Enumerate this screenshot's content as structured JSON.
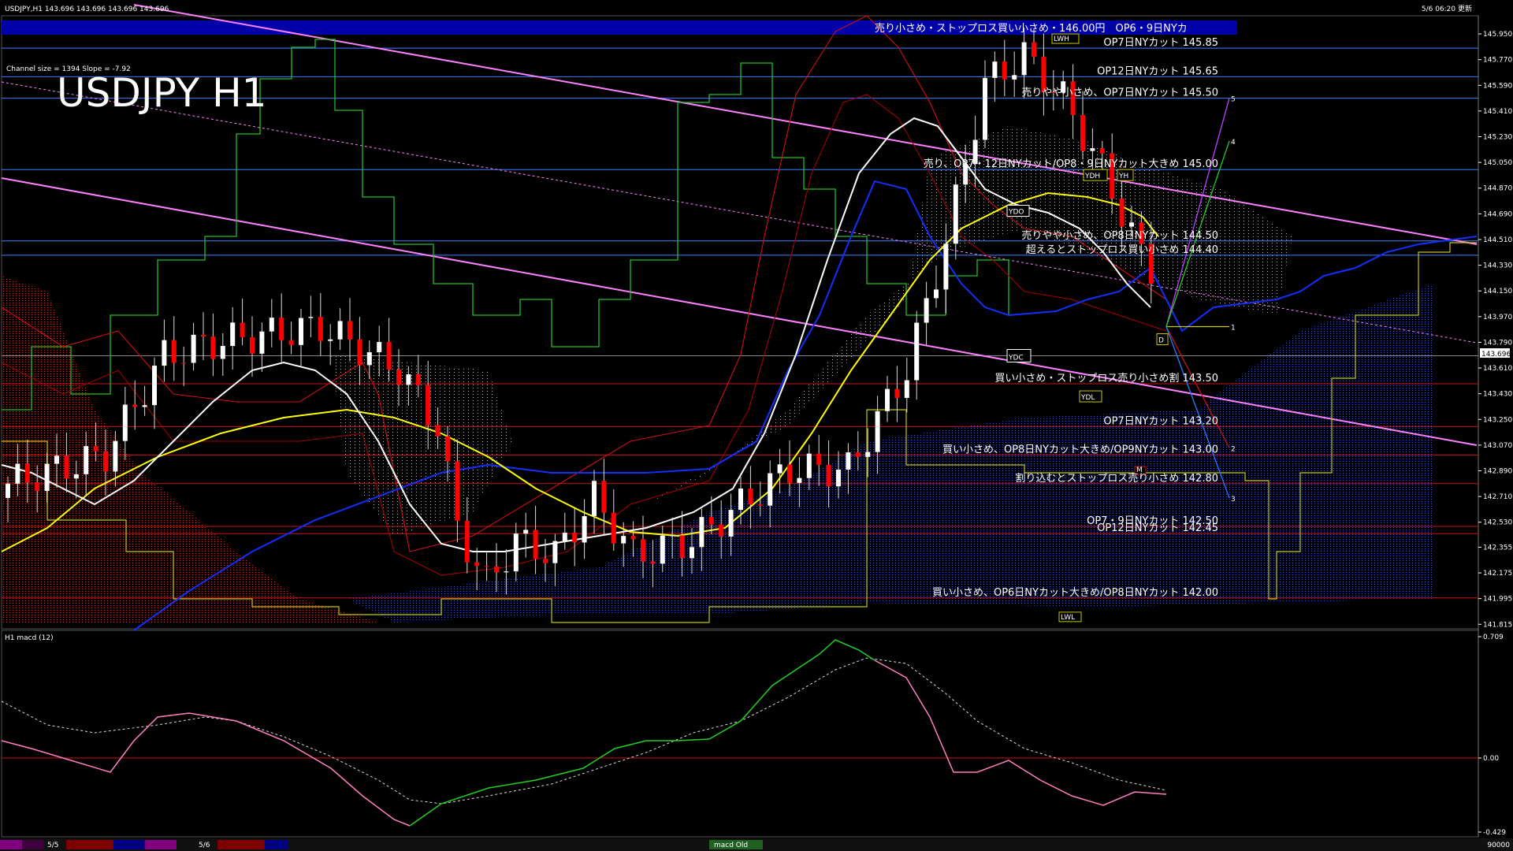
{
  "header": {
    "symbol_info": "USDJPY,H1  143.696 143.696 143.696 143.696",
    "updated": "5/6 06:20 更新",
    "channel_info": "Channel size = 1394 Slope = -7.92"
  },
  "chart_data": {
    "type": "line",
    "title": "USDJPY H1",
    "y_ticks": [
      "145.950",
      "145.770",
      "145.590",
      "145.410",
      "145.230",
      "145.050",
      "144.870",
      "144.690",
      "144.510",
      "144.330",
      "144.150",
      "143.970",
      "143.790",
      "143.610",
      "143.430",
      "143.250",
      "143.070",
      "142.890",
      "142.710",
      "142.530",
      "142.355",
      "142.175",
      "141.995",
      "141.815"
    ],
    "current_price": "143.696",
    "ylim": [
      141.8,
      146.0
    ],
    "levels": [
      {
        "price": 146.0,
        "label": "売り小さめ・ストップロス買い小さめ・146.00円　OP6・9日NYカ"
      },
      {
        "price": 145.85,
        "label": "OP7日NYカット 145.85"
      },
      {
        "price": 145.65,
        "label": "OP12日NYカット 145.65"
      },
      {
        "price": 145.5,
        "label": "売りやや小さめ、OP7日NYカット 145.50"
      },
      {
        "price": 145.0,
        "label": "売り、OP7・12日NYカット/OP8・9日NYカット大きめ 145.00"
      },
      {
        "price": 144.5,
        "label": "売りやや小さめ、OP8日NYカット 144.50"
      },
      {
        "price": 144.4,
        "label": "超えるとストップロス買い小さめ 144.40"
      },
      {
        "price": 143.5,
        "label": "買い小さめ・ストップロス売り小さめ割 143.50"
      },
      {
        "price": 143.2,
        "label": "OP7日NYカット 143.20"
      },
      {
        "price": 143.0,
        "label": "買い小さめ、OP8日NYカット大きめ/OP9NYカット 143.00"
      },
      {
        "price": 142.8,
        "label": "割り込むとストップロス売り小さめ 142.80"
      },
      {
        "price": 142.5,
        "label": "OP7・9日NYカット 142.50"
      },
      {
        "price": 142.45,
        "label": "OP12日NYカット 142.45"
      },
      {
        "price": 142.0,
        "label": "買い小さめ、OP6日NYカット大きめ/OP8日NYカット 142.00"
      }
    ],
    "scenario_labels": [
      "5",
      "4",
      "1",
      "2",
      "3"
    ],
    "box_labels": [
      "LWH",
      "YDH",
      "YDO",
      "YDC",
      "YDL",
      "LWL",
      "YH",
      "D",
      "M"
    ],
    "macd": {
      "title": "H1  macd (12)",
      "ticks": [
        "0.709",
        "0.00",
        "-0.429"
      ]
    }
  },
  "bottom_bar": {
    "dates": [
      "5/5",
      "5/6"
    ],
    "tab": "macd Old",
    "right_value": "90000"
  }
}
